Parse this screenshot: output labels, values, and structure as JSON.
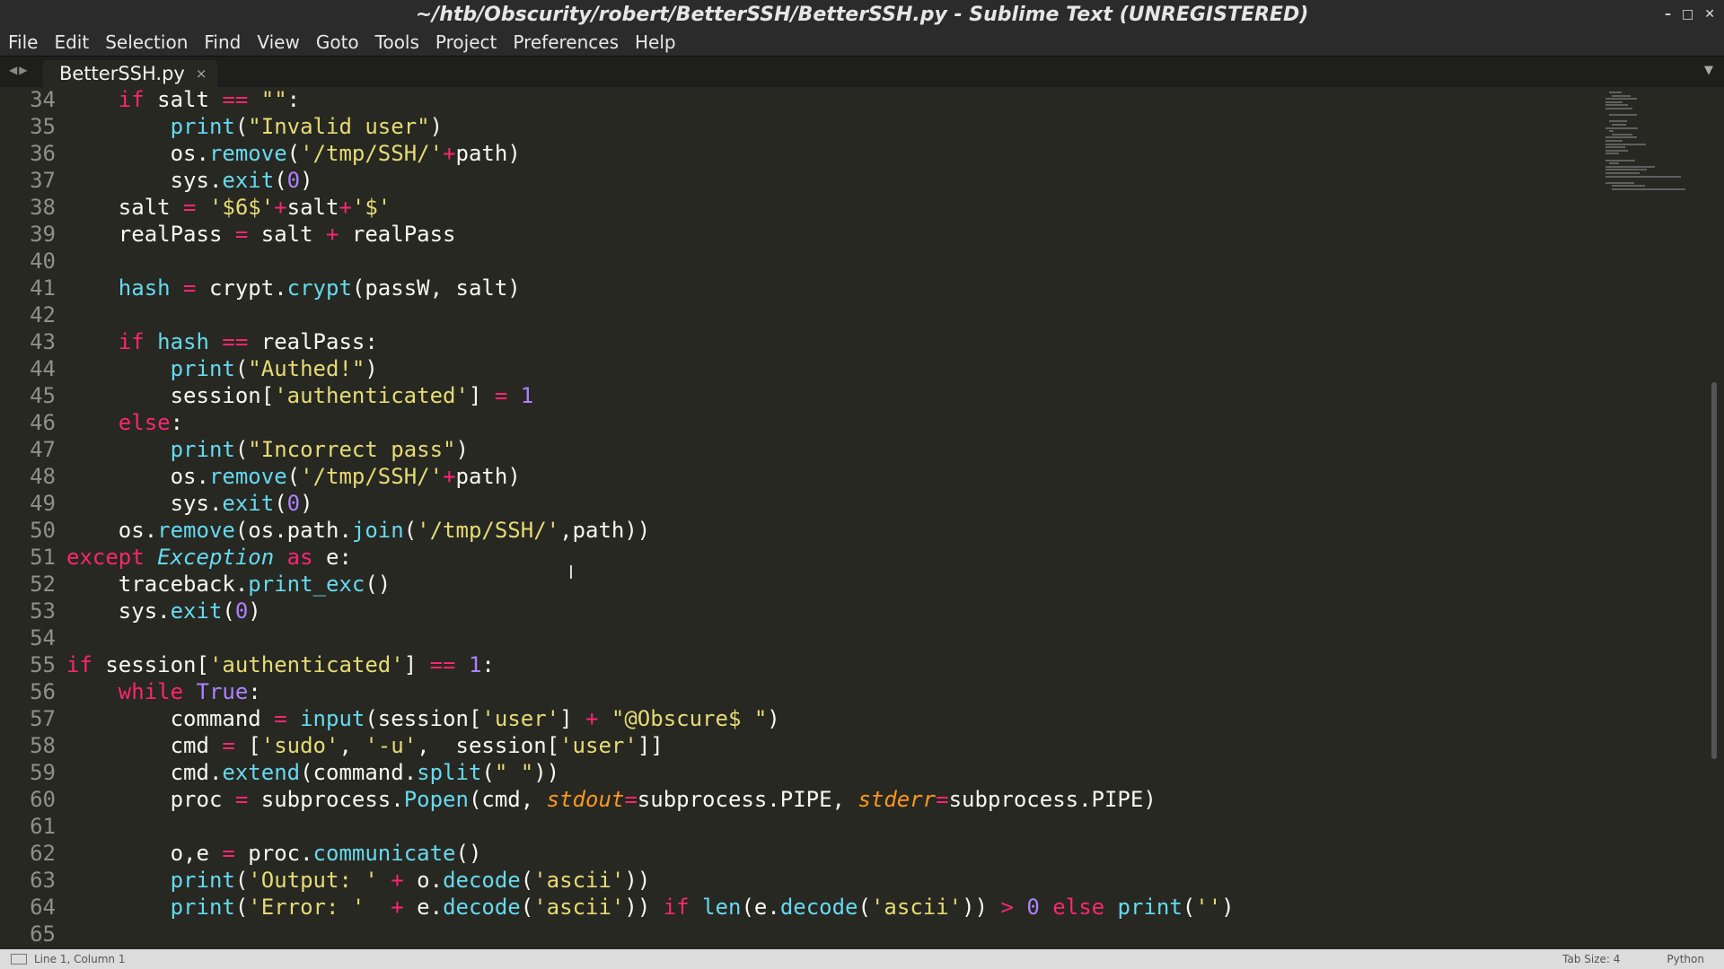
{
  "window": {
    "title": "~/htb/Obscurity/robert/BetterSSH/BetterSSH.py - Sublime Text (UNREGISTERED)",
    "controls": [
      "–",
      "□",
      "✕"
    ]
  },
  "menu": [
    "File",
    "Edit",
    "Selection",
    "Find",
    "View",
    "Goto",
    "Tools",
    "Project",
    "Preferences",
    "Help"
  ],
  "tabs": [
    {
      "label": "BetterSSH.py",
      "close": "×"
    }
  ],
  "editor": {
    "line_start": 34,
    "lines": [
      [
        [
          "    "
        ],
        [
          "if",
          "k"
        ],
        [
          " salt "
        ],
        [
          "==",
          "k"
        ],
        [
          " "
        ],
        [
          "\"\"",
          "s"
        ],
        [
          ":"
        ]
      ],
      [
        [
          "        "
        ],
        [
          "print",
          "f"
        ],
        [
          "("
        ],
        [
          "\"Invalid user\"",
          "s"
        ],
        [
          ")"
        ]
      ],
      [
        [
          "        os."
        ],
        [
          "remove",
          "f"
        ],
        [
          "("
        ],
        [
          "'/tmp/SSH/'",
          "s"
        ],
        [
          "+",
          "k"
        ],
        [
          "path)"
        ]
      ],
      [
        [
          "        sys."
        ],
        [
          "exit",
          "f"
        ],
        [
          "("
        ],
        [
          "0",
          "n"
        ],
        [
          ")"
        ]
      ],
      [
        [
          "    salt "
        ],
        [
          "=",
          "k"
        ],
        [
          " "
        ],
        [
          "'$6$'",
          "s"
        ],
        [
          "+",
          "k"
        ],
        [
          "salt"
        ],
        [
          "+",
          "k"
        ],
        [
          "'$'",
          "s"
        ]
      ],
      [
        [
          "    realPass "
        ],
        [
          "=",
          "k"
        ],
        [
          " salt "
        ],
        [
          "+",
          "k"
        ],
        [
          " realPass"
        ]
      ],
      [],
      [
        [
          "    "
        ],
        [
          "hash",
          "f"
        ],
        [
          " "
        ],
        [
          "=",
          "k"
        ],
        [
          " crypt."
        ],
        [
          "crypt",
          "f"
        ],
        [
          "(passW, salt)"
        ]
      ],
      [],
      [
        [
          "    "
        ],
        [
          "if",
          "k"
        ],
        [
          " "
        ],
        [
          "hash",
          "f"
        ],
        [
          " "
        ],
        [
          "==",
          "k"
        ],
        [
          " realPass:"
        ]
      ],
      [
        [
          "        "
        ],
        [
          "print",
          "f"
        ],
        [
          "("
        ],
        [
          "\"Authed!\"",
          "s"
        ],
        [
          ")"
        ]
      ],
      [
        [
          "        session["
        ],
        [
          "'authenticated'",
          "s"
        ],
        [
          "] "
        ],
        [
          "=",
          "k"
        ],
        [
          " "
        ],
        [
          "1",
          "n"
        ]
      ],
      [
        [
          "    "
        ],
        [
          "else",
          "k"
        ],
        [
          ":"
        ]
      ],
      [
        [
          "        "
        ],
        [
          "print",
          "f"
        ],
        [
          "("
        ],
        [
          "\"Incorrect pass\"",
          "s"
        ],
        [
          ")"
        ]
      ],
      [
        [
          "        os."
        ],
        [
          "remove",
          "f"
        ],
        [
          "("
        ],
        [
          "'/tmp/SSH/'",
          "s"
        ],
        [
          "+",
          "k"
        ],
        [
          "path)"
        ]
      ],
      [
        [
          "        sys."
        ],
        [
          "exit",
          "f"
        ],
        [
          "("
        ],
        [
          "0",
          "n"
        ],
        [
          ")"
        ]
      ],
      [
        [
          "    os."
        ],
        [
          "remove",
          "f"
        ],
        [
          "(os.path."
        ],
        [
          "join",
          "f"
        ],
        [
          "("
        ],
        [
          "'/tmp/SSH/'",
          "s"
        ],
        [
          ",path))"
        ]
      ],
      [
        [
          "except",
          "k"
        ],
        [
          " "
        ],
        [
          "Exception",
          "i"
        ],
        [
          " "
        ],
        [
          "as",
          "k"
        ],
        [
          " e:"
        ]
      ],
      [
        [
          "    traceback."
        ],
        [
          "print_exc",
          "f"
        ],
        [
          "()"
        ]
      ],
      [
        [
          "    sys."
        ],
        [
          "exit",
          "f"
        ],
        [
          "("
        ],
        [
          "0",
          "n"
        ],
        [
          ")"
        ]
      ],
      [],
      [
        [
          "if",
          "k"
        ],
        [
          " session["
        ],
        [
          "'authenticated'",
          "s"
        ],
        [
          "] "
        ],
        [
          "==",
          "k"
        ],
        [
          " "
        ],
        [
          "1",
          "n"
        ],
        [
          ":"
        ]
      ],
      [
        [
          "    "
        ],
        [
          "while",
          "k"
        ],
        [
          " "
        ],
        [
          "True",
          "n"
        ],
        [
          ":"
        ]
      ],
      [
        [
          "        command "
        ],
        [
          "=",
          "k"
        ],
        [
          " "
        ],
        [
          "input",
          "f"
        ],
        [
          "(session["
        ],
        [
          "'user'",
          "s"
        ],
        [
          "] "
        ],
        [
          "+",
          "k"
        ],
        [
          " "
        ],
        [
          "\"@Obscure$ \"",
          "s"
        ],
        [
          ")"
        ]
      ],
      [
        [
          "        cmd "
        ],
        [
          "=",
          "k"
        ],
        [
          " ["
        ],
        [
          "'sudo'",
          "s"
        ],
        [
          ", "
        ],
        [
          "'-u'",
          "s"
        ],
        [
          ",  session["
        ],
        [
          "'user'",
          "s"
        ],
        [
          "]]"
        ]
      ],
      [
        [
          "        cmd."
        ],
        [
          "extend",
          "f"
        ],
        [
          "(command."
        ],
        [
          "split",
          "f"
        ],
        [
          "("
        ],
        [
          "\" \"",
          "s"
        ],
        [
          "))"
        ]
      ],
      [
        [
          "        proc "
        ],
        [
          "=",
          "k"
        ],
        [
          " subprocess."
        ],
        [
          "Popen",
          "f"
        ],
        [
          "(cmd, "
        ],
        [
          "stdout",
          "p"
        ],
        [
          "=",
          "k"
        ],
        [
          "subprocess.PIPE, "
        ],
        [
          "stderr",
          "p"
        ],
        [
          "=",
          "k"
        ],
        [
          "subprocess.PIPE)"
        ]
      ],
      [],
      [
        [
          "        o,e "
        ],
        [
          "=",
          "k"
        ],
        [
          " proc."
        ],
        [
          "communicate",
          "f"
        ],
        [
          "()"
        ]
      ],
      [
        [
          "        "
        ],
        [
          "print",
          "f"
        ],
        [
          "("
        ],
        [
          "'Output: '",
          "s"
        ],
        [
          " "
        ],
        [
          "+",
          "k"
        ],
        [
          " o."
        ],
        [
          "decode",
          "f"
        ],
        [
          "("
        ],
        [
          "'ascii'",
          "s"
        ],
        [
          "))"
        ]
      ],
      [
        [
          "        "
        ],
        [
          "print",
          "f"
        ],
        [
          "("
        ],
        [
          "'Error: '",
          "s"
        ],
        [
          "  "
        ],
        [
          "+",
          "k"
        ],
        [
          " e."
        ],
        [
          "decode",
          "f"
        ],
        [
          "("
        ],
        [
          "'ascii'",
          "s"
        ],
        [
          ")) "
        ],
        [
          "if",
          "k"
        ],
        [
          " "
        ],
        [
          "len",
          "f"
        ],
        [
          "(e."
        ],
        [
          "decode",
          "f"
        ],
        [
          "("
        ],
        [
          "'ascii'",
          "s"
        ],
        [
          ")) "
        ],
        [
          ">",
          "k"
        ],
        [
          " "
        ],
        [
          "0",
          "n"
        ],
        [
          " "
        ],
        [
          "else",
          "k"
        ],
        [
          " "
        ],
        [
          "print",
          "f"
        ],
        [
          "("
        ],
        [
          "''",
          "s"
        ],
        [
          ")"
        ]
      ],
      []
    ]
  },
  "status": {
    "position": "Line 1, Column 1",
    "tab_size": "Tab Size: 4",
    "syntax": "Python"
  },
  "colors": {
    "background": "#272822",
    "keyword": "#f92672",
    "function": "#66d9ef",
    "string": "#e6db74",
    "number": "#ae81ff",
    "parameter": "#fd971f",
    "foreground": "#f8f8f2"
  }
}
